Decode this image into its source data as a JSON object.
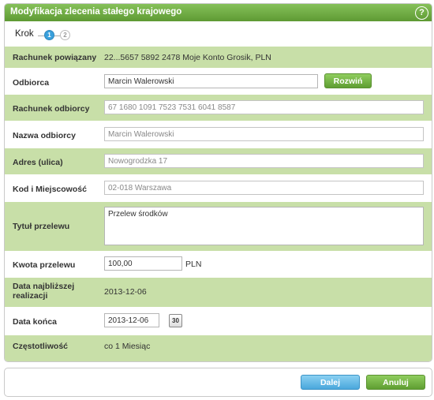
{
  "dialog": {
    "title": "Modyfikacja zlecenia stałego krajowego",
    "help_icon_text": "?"
  },
  "steps": {
    "label": "Krok",
    "items": [
      {
        "number": "1",
        "active": true
      },
      {
        "number": "2",
        "active": false
      }
    ]
  },
  "form": {
    "linked_account": {
      "label": "Rachunek powiązany",
      "value": "22...5657 5892 2478 Moje Konto Grosik, PLN"
    },
    "recipient": {
      "label": "Odbiorca",
      "value": "Marcin Walerowski",
      "expand_button": "Rozwiń"
    },
    "recipient_account": {
      "label": "Rachunek odbiorcy",
      "value": "67 1680 1091 7523 7531 6041 8587"
    },
    "recipient_name": {
      "label": "Nazwa odbiorcy",
      "value": "Marcin Walerowski"
    },
    "address": {
      "label": "Adres (ulica)",
      "value": "Nowogrodzka 17"
    },
    "postal_city": {
      "label": "Kod i Miejscowość",
      "value": "02-018 Warszawa"
    },
    "transfer_title": {
      "label": "Tytuł przelewu",
      "value": "Przelew środków"
    },
    "amount": {
      "label": "Kwota przelewu",
      "value": "100,00",
      "currency": "PLN"
    },
    "nearest_date": {
      "label_line1": "Data najbliższej",
      "label_line2": "realizacji",
      "value": "2013-12-06"
    },
    "end_date": {
      "label": "Data końca",
      "value": "2013-12-06",
      "calendar_icon_text": "30"
    },
    "frequency": {
      "label": "Częstotliwość",
      "value": "co 1 Miesiąc"
    }
  },
  "footer": {
    "next_button": "Dalej",
    "cancel_button": "Anuluj"
  },
  "colors": {
    "title_bar": "#6cab41",
    "row_green": "#c8dfa8",
    "accent_blue": "#4aa7dc"
  }
}
